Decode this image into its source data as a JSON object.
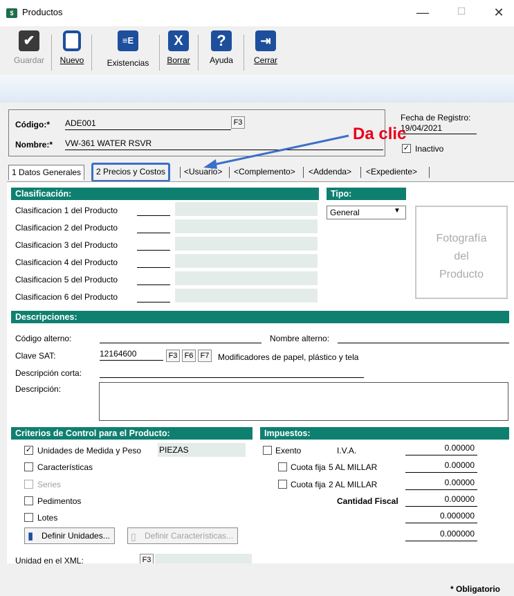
{
  "window": {
    "title": "Productos",
    "min": "—",
    "max": "☐",
    "close": "✕"
  },
  "toolbar": {
    "guardar": "Guardar",
    "nuevo": "Nuevo",
    "existencias": "Existencias",
    "borrar": "Borrar",
    "ayuda": "Ayuda",
    "cerrar": "Cerrar"
  },
  "header": {
    "codigo_label": "Código:*",
    "codigo_value": "ADE001",
    "f3": "F3",
    "nombre_label": "Nombre:*",
    "nombre_value": "VW-361 WATER RSVR",
    "fecha_label": "Fecha de Registro:",
    "fecha_value": "19/04/2021",
    "inactivo_label": "Inactivo",
    "inactivo_checked": "✓"
  },
  "callout": "Da clic",
  "tabs": [
    "1 Datos Generales",
    "2 Precios y Costos",
    "<Usuario>",
    "<Complemento>",
    "<Addenda>",
    "<Expediente>"
  ],
  "clasificacion": {
    "title": "Clasificación:",
    "rows": [
      "Clasificacion 1 del Producto",
      "Clasificacion 2 del Producto",
      "Clasificacion 3 del Producto",
      "Clasificacion 4 del Producto",
      "Clasificacion 5 del Producto",
      "Clasificacion 6 del Producto"
    ]
  },
  "tipo": {
    "title": "Tipo:",
    "value": "General"
  },
  "photo": {
    "line1": "Fotografía",
    "line2": "del",
    "line3": "Producto"
  },
  "descripciones": {
    "title": "Descripciones:",
    "codigo_alterno": "Código alterno:",
    "nombre_alterno": "Nombre alterno:",
    "clave_sat_label": "Clave SAT:",
    "clave_sat_value": "12164600",
    "f3": "F3",
    "f6": "F6",
    "f7": "F7",
    "clave_sat_desc": "Modificadores de papel, plástico y tela",
    "descripcion_corta": "Descripción corta:",
    "descripcion": "Descripción:"
  },
  "criterios": {
    "title": "Criterios de Control para el Producto:",
    "unidades": "Unidades de Medida y Peso",
    "unidades_value": "PIEZAS",
    "caracteristicas": "Características",
    "series": "Series",
    "pedimentos": "Pedimentos",
    "lotes": "Lotes",
    "definir_unidades": "Definir Unidades...",
    "definir_caracteristicas": "Definir Características...",
    "unidad_xml": "Unidad en el XML:",
    "f3": "F3"
  },
  "impuestos": {
    "title": "Impuestos:",
    "exento": "Exento",
    "iva": "I.V.A.",
    "iva_value": "0.00000",
    "cuota_fija": "Cuota fija",
    "al_millar_5": "5 AL MILLAR",
    "v5": "0.00000",
    "al_millar_2": "2 AL MILLAR",
    "v2": "0.00000",
    "cantidad_fiscal": "Cantidad Fiscal",
    "cf_value": "0.00000",
    "v_extra1": "0.000000",
    "v_extra2": "0.000000"
  },
  "footer": {
    "obligatorio": "* Obligatorio"
  },
  "colors": {
    "section": "#0f8070",
    "accent_blue": "#3b6fc9",
    "callout_red": "#e8001a"
  }
}
